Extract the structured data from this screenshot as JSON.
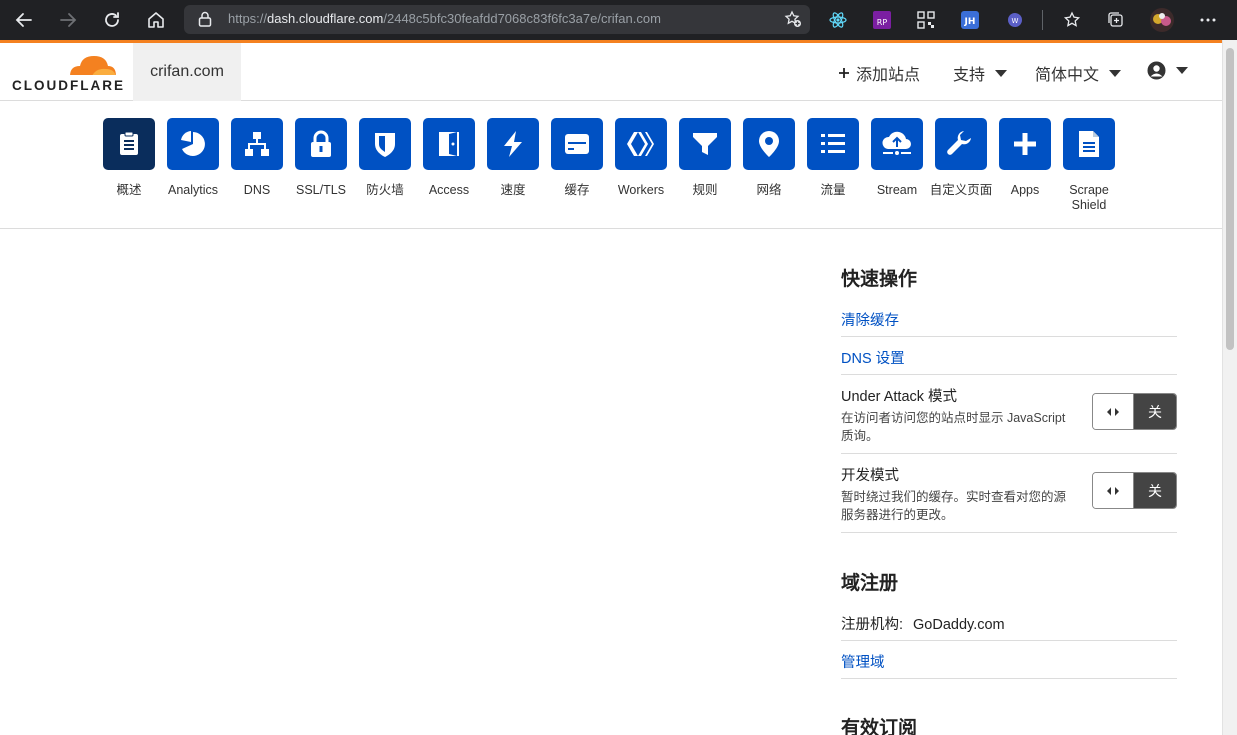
{
  "browser": {
    "url_scheme": "https://",
    "url_host": "dash.cloudflare.com",
    "url_path": "/2448c5bfc30feafdd7068c83f6fc3a7e/crifan.com",
    "extensions": [
      "react-devtools-icon",
      "rp-extension-icon",
      "qr-code-icon",
      "jh-extension-icon",
      "translate-extension-icon"
    ]
  },
  "header": {
    "logo_text": "CLOUDFLARE",
    "site_name": "crifan.com",
    "add_site_label": "添加站点",
    "support_label": "支持",
    "language_label": "简体中文"
  },
  "nav": [
    {
      "label": "概述",
      "icon": "document-icon",
      "active": true
    },
    {
      "label": "Analytics",
      "icon": "pie-chart-icon"
    },
    {
      "label": "DNS",
      "icon": "network-tree-icon"
    },
    {
      "label": "SSL/TLS",
      "icon": "lock-icon"
    },
    {
      "label": "防火墙",
      "icon": "shield-icon"
    },
    {
      "label": "Access",
      "icon": "door-icon"
    },
    {
      "label": "速度",
      "icon": "lightning-icon"
    },
    {
      "label": "缓存",
      "icon": "storage-icon"
    },
    {
      "label": "Workers",
      "icon": "workers-icon"
    },
    {
      "label": "规则",
      "icon": "filter-icon"
    },
    {
      "label": "网络",
      "icon": "location-pin-icon"
    },
    {
      "label": "流量",
      "icon": "list-icon"
    },
    {
      "label": "Stream",
      "icon": "cloud-upload-icon"
    },
    {
      "label": "自定义页面",
      "icon": "wrench-icon"
    },
    {
      "label": "Apps",
      "icon": "plus-icon"
    },
    {
      "label": "Scrape",
      "label2": "Shield",
      "icon": "file-icon"
    }
  ],
  "quick_actions": {
    "title": "快速操作",
    "purge_cache": "清除缓存",
    "dns_settings": "DNS 设置",
    "under_attack_title": "Under Attack 模式",
    "under_attack_desc": "在访问者访问您的站点时显示 JavaScript 质询。",
    "under_attack_state": "关",
    "dev_mode_title": "开发模式",
    "dev_mode_desc": "暂时绕过我们的缓存。实时查看对您的源服务器进行的更改。",
    "dev_mode_state": "关"
  },
  "domain_registration": {
    "title": "域注册",
    "registrar_label": "注册机构:",
    "registrar_value": "GoDaddy.com",
    "manage_link": "管理域"
  },
  "subscriptions": {
    "title": "有效订阅"
  }
}
